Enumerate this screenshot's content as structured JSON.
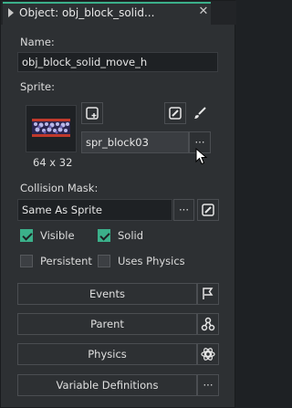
{
  "tab": {
    "title": "Object: obj_block_solid..."
  },
  "name": {
    "label": "Name:",
    "value": "obj_block_solid_move_h"
  },
  "sprite": {
    "label": "Sprite:",
    "value": "spr_block03",
    "size": "64 x 32",
    "more": "···"
  },
  "collision": {
    "label": "Collision Mask:",
    "value": "Same As Sprite",
    "more": "···"
  },
  "checks": {
    "visible": {
      "label": "Visible",
      "checked": true
    },
    "solid": {
      "label": "Solid",
      "checked": true
    },
    "persistent": {
      "label": "Persistent",
      "checked": false
    },
    "physics": {
      "label": "Uses Physics",
      "checked": false
    }
  },
  "buttons": {
    "events": "Events",
    "parent": "Parent",
    "physics": "Physics",
    "variables": "Variable Definitions",
    "variables_more": "···"
  },
  "colors": {
    "accent": "#3bb08a",
    "panel": "#2d3033",
    "field": "#1e2124"
  },
  "icons": [
    "chevron-right-icon",
    "close-icon",
    "new-sprite-icon",
    "edit-sprite-icon",
    "brush-icon",
    "edit-mask-icon",
    "flag-icon",
    "hierarchy-icon",
    "gear-icon"
  ]
}
